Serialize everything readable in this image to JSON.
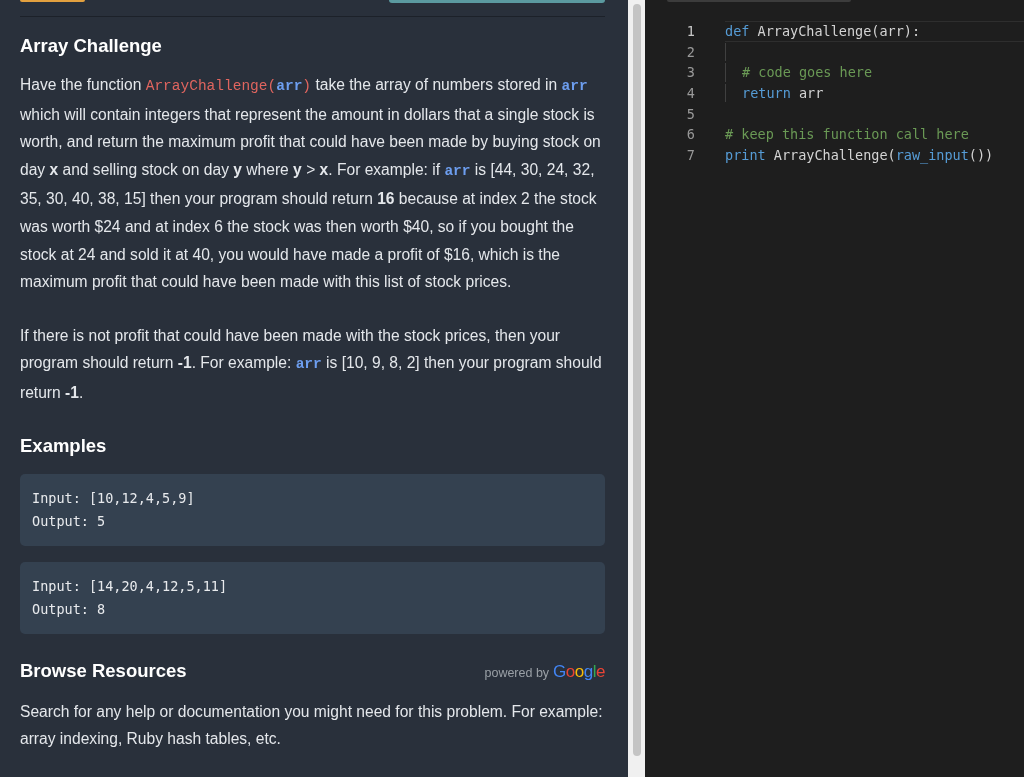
{
  "title": "Array Challenge",
  "description": [
    [
      {
        "kind": "text",
        "text": "Have the function "
      },
      {
        "kind": "code",
        "text": "ArrayChallenge("
      },
      {
        "kind": "var",
        "text": "arr"
      },
      {
        "kind": "code",
        "text": ")"
      },
      {
        "kind": "text",
        "text": " take the array of numbers stored in "
      },
      {
        "kind": "var",
        "text": "arr"
      },
      {
        "kind": "text",
        "text": " which will contain integers that represent the amount in dollars that a single stock is worth, and return the maximum profit that could have been made by buying stock on day **x** and selling stock on day **y** where **y** > **x**. For example: if "
      },
      {
        "kind": "var",
        "text": "arr"
      },
      {
        "kind": "text",
        "text": " is [44, 30, 24, 32, 35, 30, 40, 38, 15] then your program should return **16** because at index 2 the stock was worth $24 and at index 6 the stock was then worth $40, so if you bought the stock at 24 and sold it at 40, you would have made a profit of $16, which is the maximum profit that could have been made with this list of stock prices."
      }
    ],
    [
      {
        "kind": "text",
        "text": "If there is not profit that could have been made with the stock prices, then your program should return **-1**. For example: "
      },
      {
        "kind": "var",
        "text": "arr"
      },
      {
        "kind": "text",
        "text": " is [10, 9, 8, 2] then your program should return **-1**."
      }
    ]
  ],
  "examples_heading": "Examples",
  "examples": [
    {
      "input_label": "Input:",
      "input": "[10,12,4,5,9]",
      "output_label": "Output:",
      "output": "5"
    },
    {
      "input_label": "Input:",
      "input": "[14,20,4,12,5,11]",
      "output_label": "Output:",
      "output": "8"
    }
  ],
  "resources": {
    "heading": "Browse Resources",
    "powered_by": "powered by",
    "brand": "Google",
    "text": "Search for any help or documentation you might need for this problem. For example: array indexing, Ruby hash tables, etc."
  },
  "editor": {
    "lines": [
      {
        "number": "1",
        "current": true,
        "indented": false,
        "tokens": [
          {
            "kind": "keyword",
            "text": "def"
          },
          {
            "kind": "plain",
            "text": " ArrayChallenge(arr):"
          }
        ]
      },
      {
        "number": "2",
        "current": false,
        "indented": true
      },
      {
        "number": "3",
        "current": false,
        "indented": true,
        "tokens": [
          {
            "kind": "comment",
            "text": "# code goes here"
          }
        ]
      },
      {
        "number": "4",
        "current": false,
        "indented": true,
        "tokens": [
          {
            "kind": "keyword",
            "text": "return"
          },
          {
            "kind": "plain",
            "text": " arr"
          }
        ]
      },
      {
        "number": "5",
        "current": false,
        "indented": false
      },
      {
        "number": "6",
        "current": false,
        "indented": false,
        "tokens": [
          {
            "kind": "comment",
            "text": "# keep this function call here"
          }
        ]
      },
      {
        "number": "7",
        "current": false,
        "indented": false,
        "tokens": [
          {
            "kind": "keyword",
            "text": "print"
          },
          {
            "kind": "plain",
            "text": " ArrayChallenge("
          },
          {
            "kind": "builtin",
            "text": "raw_input"
          },
          {
            "kind": "plain",
            "text": "())"
          }
        ]
      }
    ]
  }
}
